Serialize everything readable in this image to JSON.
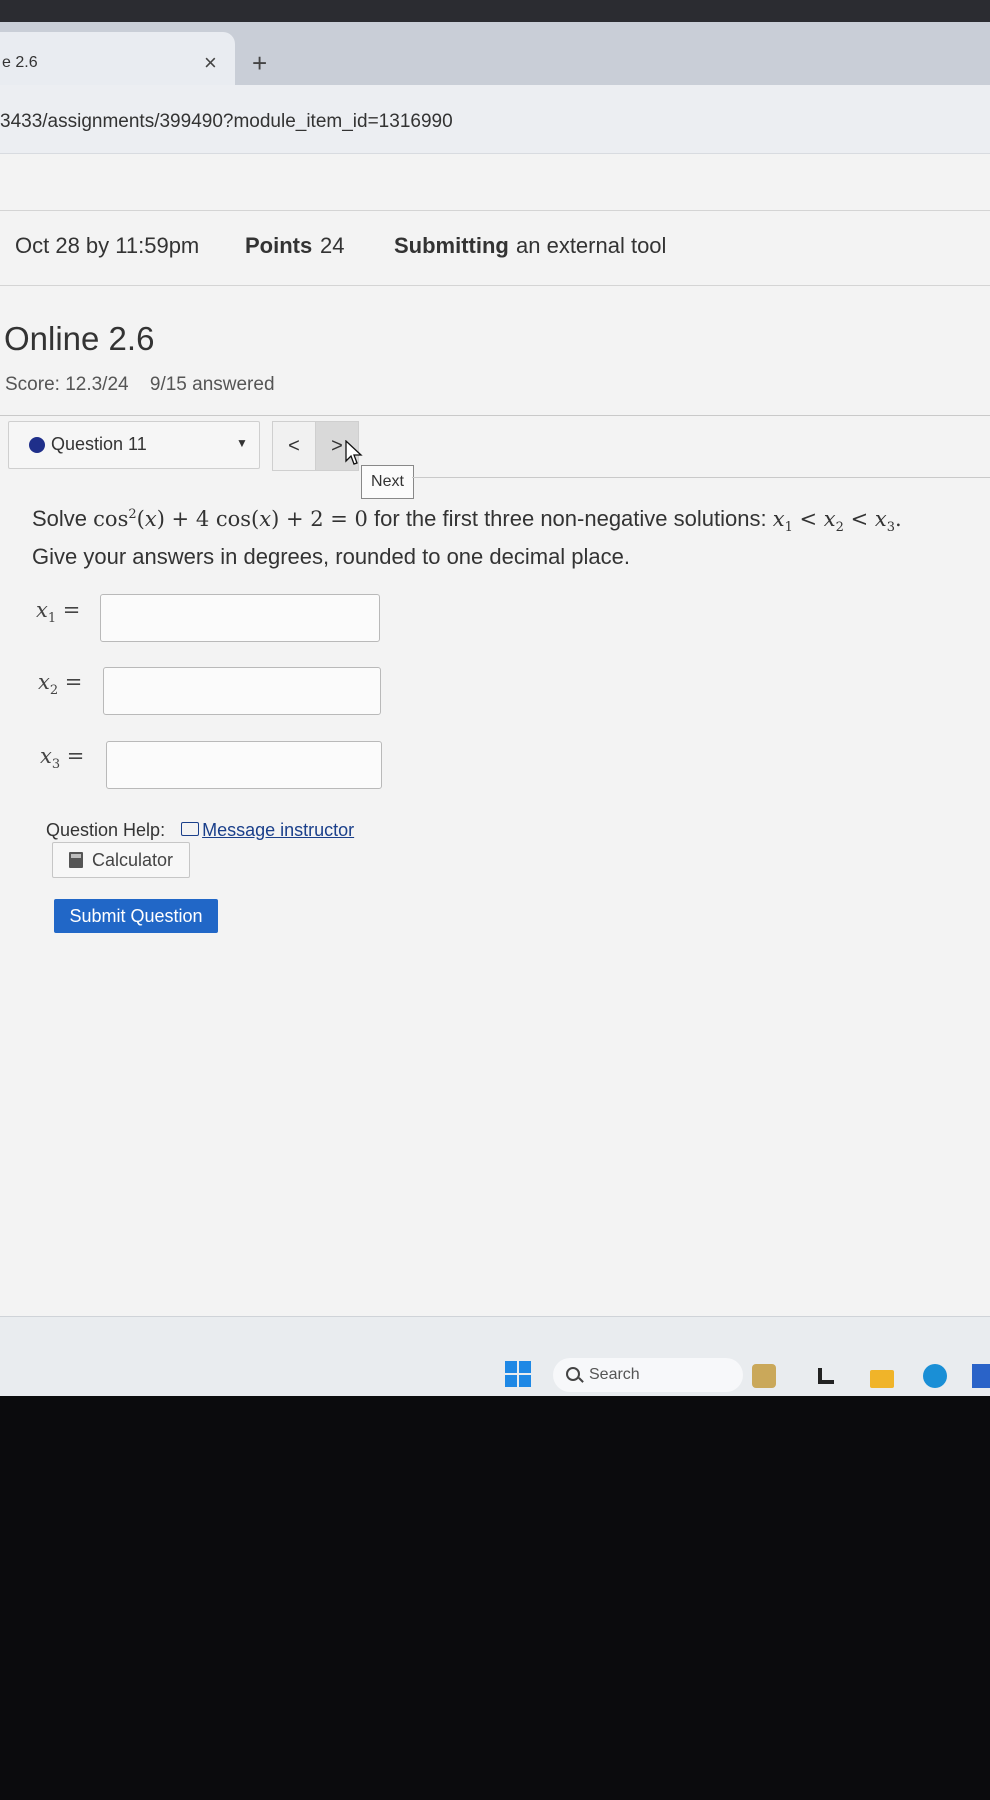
{
  "browser": {
    "tab_title": "e 2.6",
    "tab_close": "×",
    "new_tab": "+",
    "url": "3433/assignments/399490?module_item_id=1316990"
  },
  "assignment_info": {
    "due": "Oct 28 by 11:59pm",
    "points_label": "Points",
    "points_value": "24",
    "submitting_label": "Submitting",
    "submitting_value": "an external tool"
  },
  "quiz": {
    "title": "Online 2.6",
    "score": "Score: 12.3/24",
    "answered": "9/15 answered",
    "question_select": "Question 11",
    "prev_label": "<",
    "next_label": ">",
    "tooltip": "Next"
  },
  "question": {
    "prefix": "Solve",
    "suffix": "for the first three non-negative solutions:",
    "line2": "Give your answers in degrees, rounded to one decimal place."
  },
  "answers": [
    {
      "label": "x",
      "sub": "1",
      "value": ""
    },
    {
      "label": "x",
      "sub": "2",
      "value": ""
    },
    {
      "label": "x",
      "sub": "3",
      "value": ""
    }
  ],
  "help": {
    "label": "Question Help:",
    "message_link": "Message instructor",
    "calculator": "Calculator",
    "submit": "Submit Question"
  },
  "taskbar": {
    "search_placeholder": "Search"
  },
  "colors": {
    "accent": "#2167c7",
    "question_dot": "#1f2f8a",
    "link": "#1a3f8a"
  }
}
